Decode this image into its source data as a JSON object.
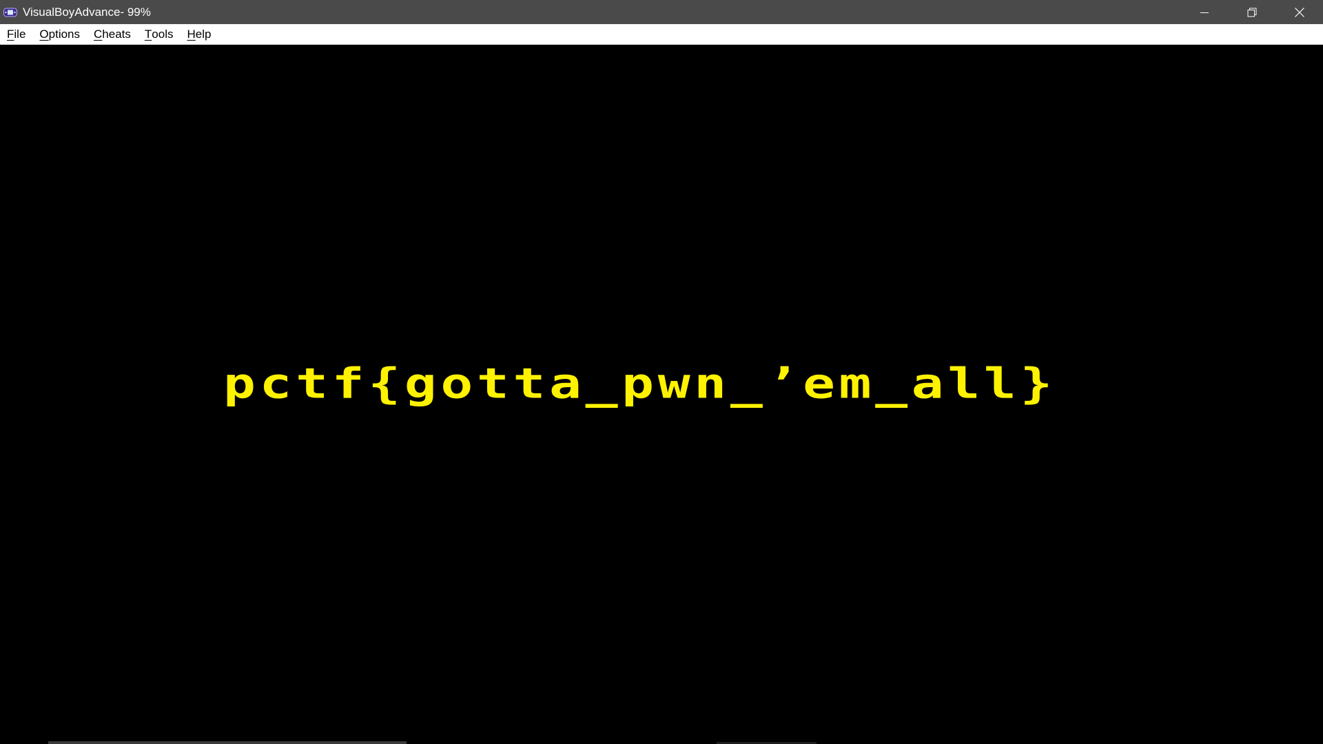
{
  "window": {
    "title": "VisualBoyAdvance- 99%",
    "app_icon": "gameboy-advance-icon",
    "controls": {
      "minimize_icon": "minimize-icon",
      "restore_icon": "restore-icon",
      "close_icon": "close-icon"
    },
    "titlebar_color": "#4a4a4a"
  },
  "menubar": {
    "items": [
      {
        "mnemonic": "F",
        "rest": "ile"
      },
      {
        "mnemonic": "O",
        "rest": "ptions"
      },
      {
        "mnemonic": "C",
        "rest": "heats"
      },
      {
        "mnemonic": "T",
        "rest": "ools"
      },
      {
        "mnemonic": "H",
        "rest": "elp"
      }
    ]
  },
  "game": {
    "flag_text": "pctf{gotta_pwn_’em_all}",
    "text_color": "#fff200",
    "background_color": "#000000"
  }
}
